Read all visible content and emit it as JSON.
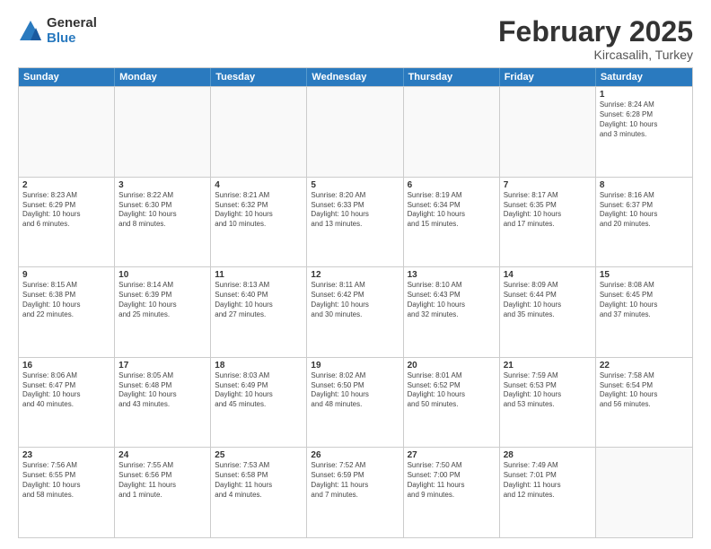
{
  "logo": {
    "general": "General",
    "blue": "Blue"
  },
  "title": "February 2025",
  "subtitle": "Kircasalih, Turkey",
  "header_days": [
    "Sunday",
    "Monday",
    "Tuesday",
    "Wednesday",
    "Thursday",
    "Friday",
    "Saturday"
  ],
  "weeks": [
    [
      {
        "day": "",
        "info": ""
      },
      {
        "day": "",
        "info": ""
      },
      {
        "day": "",
        "info": ""
      },
      {
        "day": "",
        "info": ""
      },
      {
        "day": "",
        "info": ""
      },
      {
        "day": "",
        "info": ""
      },
      {
        "day": "1",
        "info": "Sunrise: 8:24 AM\nSunset: 6:28 PM\nDaylight: 10 hours\nand 3 minutes."
      }
    ],
    [
      {
        "day": "2",
        "info": "Sunrise: 8:23 AM\nSunset: 6:29 PM\nDaylight: 10 hours\nand 6 minutes."
      },
      {
        "day": "3",
        "info": "Sunrise: 8:22 AM\nSunset: 6:30 PM\nDaylight: 10 hours\nand 8 minutes."
      },
      {
        "day": "4",
        "info": "Sunrise: 8:21 AM\nSunset: 6:32 PM\nDaylight: 10 hours\nand 10 minutes."
      },
      {
        "day": "5",
        "info": "Sunrise: 8:20 AM\nSunset: 6:33 PM\nDaylight: 10 hours\nand 13 minutes."
      },
      {
        "day": "6",
        "info": "Sunrise: 8:19 AM\nSunset: 6:34 PM\nDaylight: 10 hours\nand 15 minutes."
      },
      {
        "day": "7",
        "info": "Sunrise: 8:17 AM\nSunset: 6:35 PM\nDaylight: 10 hours\nand 17 minutes."
      },
      {
        "day": "8",
        "info": "Sunrise: 8:16 AM\nSunset: 6:37 PM\nDaylight: 10 hours\nand 20 minutes."
      }
    ],
    [
      {
        "day": "9",
        "info": "Sunrise: 8:15 AM\nSunset: 6:38 PM\nDaylight: 10 hours\nand 22 minutes."
      },
      {
        "day": "10",
        "info": "Sunrise: 8:14 AM\nSunset: 6:39 PM\nDaylight: 10 hours\nand 25 minutes."
      },
      {
        "day": "11",
        "info": "Sunrise: 8:13 AM\nSunset: 6:40 PM\nDaylight: 10 hours\nand 27 minutes."
      },
      {
        "day": "12",
        "info": "Sunrise: 8:11 AM\nSunset: 6:42 PM\nDaylight: 10 hours\nand 30 minutes."
      },
      {
        "day": "13",
        "info": "Sunrise: 8:10 AM\nSunset: 6:43 PM\nDaylight: 10 hours\nand 32 minutes."
      },
      {
        "day": "14",
        "info": "Sunrise: 8:09 AM\nSunset: 6:44 PM\nDaylight: 10 hours\nand 35 minutes."
      },
      {
        "day": "15",
        "info": "Sunrise: 8:08 AM\nSunset: 6:45 PM\nDaylight: 10 hours\nand 37 minutes."
      }
    ],
    [
      {
        "day": "16",
        "info": "Sunrise: 8:06 AM\nSunset: 6:47 PM\nDaylight: 10 hours\nand 40 minutes."
      },
      {
        "day": "17",
        "info": "Sunrise: 8:05 AM\nSunset: 6:48 PM\nDaylight: 10 hours\nand 43 minutes."
      },
      {
        "day": "18",
        "info": "Sunrise: 8:03 AM\nSunset: 6:49 PM\nDaylight: 10 hours\nand 45 minutes."
      },
      {
        "day": "19",
        "info": "Sunrise: 8:02 AM\nSunset: 6:50 PM\nDaylight: 10 hours\nand 48 minutes."
      },
      {
        "day": "20",
        "info": "Sunrise: 8:01 AM\nSunset: 6:52 PM\nDaylight: 10 hours\nand 50 minutes."
      },
      {
        "day": "21",
        "info": "Sunrise: 7:59 AM\nSunset: 6:53 PM\nDaylight: 10 hours\nand 53 minutes."
      },
      {
        "day": "22",
        "info": "Sunrise: 7:58 AM\nSunset: 6:54 PM\nDaylight: 10 hours\nand 56 minutes."
      }
    ],
    [
      {
        "day": "23",
        "info": "Sunrise: 7:56 AM\nSunset: 6:55 PM\nDaylight: 10 hours\nand 58 minutes."
      },
      {
        "day": "24",
        "info": "Sunrise: 7:55 AM\nSunset: 6:56 PM\nDaylight: 11 hours\nand 1 minute."
      },
      {
        "day": "25",
        "info": "Sunrise: 7:53 AM\nSunset: 6:58 PM\nDaylight: 11 hours\nand 4 minutes."
      },
      {
        "day": "26",
        "info": "Sunrise: 7:52 AM\nSunset: 6:59 PM\nDaylight: 11 hours\nand 7 minutes."
      },
      {
        "day": "27",
        "info": "Sunrise: 7:50 AM\nSunset: 7:00 PM\nDaylight: 11 hours\nand 9 minutes."
      },
      {
        "day": "28",
        "info": "Sunrise: 7:49 AM\nSunset: 7:01 PM\nDaylight: 11 hours\nand 12 minutes."
      },
      {
        "day": "",
        "info": ""
      }
    ]
  ]
}
